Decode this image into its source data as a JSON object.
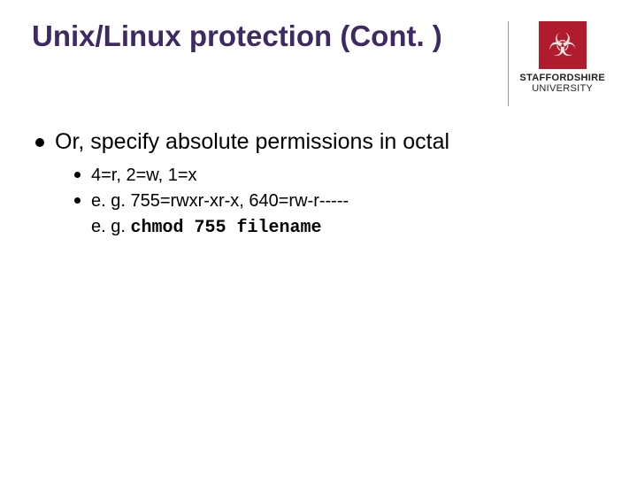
{
  "title": "Unix/Linux protection (Cont. )",
  "logo": {
    "line1": "STAFFORDSHIRE",
    "line2": "UNIVERSITY",
    "glyph": "☣"
  },
  "top_item": "Or, specify absolute permissions in octal",
  "sub": {
    "item1": "4=r, 2=w, 1=x",
    "item2_line1": "e. g. 755=rwxr-xr-x, 640=rw-r-----",
    "item2_line2_prefix": "e. g. ",
    "item2_line2_mono": "chmod 755 filename"
  }
}
